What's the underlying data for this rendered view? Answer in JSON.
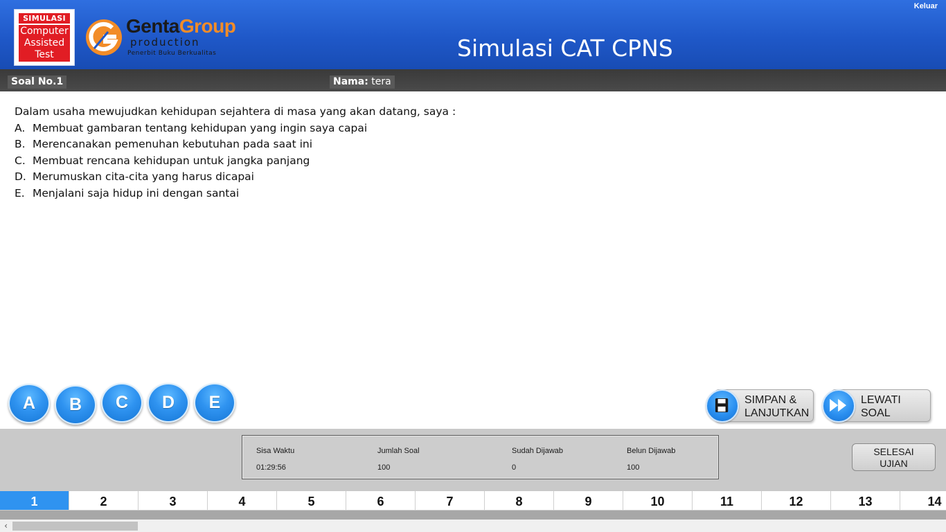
{
  "header": {
    "app_title": "Simulasi CAT CPNS",
    "logout_label": "Keluar",
    "logo_cat": {
      "top": "SIMULASI",
      "line1": "Computer",
      "line2": "Assisted",
      "line3": "Test"
    },
    "logo_genta": {
      "word1": "Genta",
      "word2": "Group",
      "sub": "production",
      "tagline": "Penerbit Buku Berkualitas"
    }
  },
  "info_bar": {
    "question_label": "Soal No.1",
    "participant_label": "Nama:",
    "participant_name": "tera"
  },
  "question": {
    "text": "Dalam usaha mewujudkan kehidupan sejahtera di masa yang akan datang, saya :",
    "options": [
      {
        "letter": "A.",
        "text": "Membuat gambaran tentang kehidupan yang ingin saya capai"
      },
      {
        "letter": "B.",
        "text": "Merencanakan pemenuhan kebutuhan pada saat ini"
      },
      {
        "letter": "C.",
        "text": "Membuat rencana kehidupan untuk jangka panjang"
      },
      {
        "letter": "D.",
        "text": "Merumuskan cita-cita yang harus dicapai"
      },
      {
        "letter": "E.",
        "text": "Menjalani saja hidup ini dengan santai"
      }
    ]
  },
  "answer_buttons": [
    "A",
    "B",
    "C",
    "D",
    "E"
  ],
  "actions": {
    "save": {
      "line1": "SIMPAN &",
      "line2": "LANJUTKAN",
      "icon": "floppy-disk-icon"
    },
    "skip": {
      "line1": "LEWATI",
      "line2": "SOAL",
      "icon": "fast-forward-icon"
    },
    "finish": {
      "line1": "SELESAI",
      "line2": "UJIAN"
    }
  },
  "status": {
    "remaining_time": {
      "label": "Sisa Waktu",
      "value": "01:29:56"
    },
    "total_questions": {
      "label": "Jumlah Soal",
      "value": "100"
    },
    "answered": {
      "label": "Sudah Dijawab",
      "value": "0"
    },
    "unanswered": {
      "label": "Belun Dijawab",
      "value": "100"
    }
  },
  "question_nav": {
    "active": "1",
    "numbers": [
      "1",
      "2",
      "3",
      "4",
      "5",
      "6",
      "7",
      "8",
      "9",
      "10",
      "11",
      "12",
      "13",
      "14"
    ]
  },
  "colors": {
    "header_blue": "#1f58c8",
    "accent_blue": "#2f93f0",
    "logo_red": "#e11d24",
    "logo_orange": "#f28c28"
  }
}
